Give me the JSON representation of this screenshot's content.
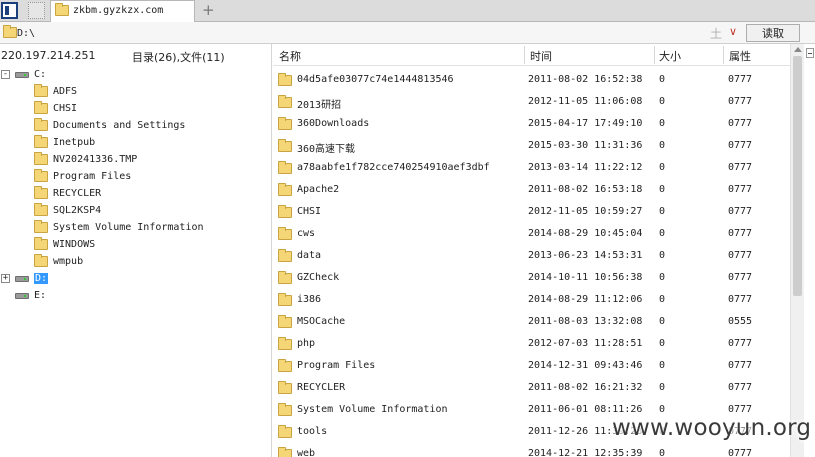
{
  "tab": {
    "title": "zkbm.gyzkzx.com",
    "add_symbol": "+"
  },
  "address": {
    "value": "D:\\",
    "clear_symbol": "土",
    "dropdown_symbol": "∨",
    "read_label": "读取"
  },
  "left": {
    "ip": "220.197.214.251",
    "counts": "目录(26),文件(11)",
    "tree": [
      {
        "label": "C:",
        "type": "drive",
        "expander": "-"
      },
      {
        "label": "ADFS",
        "type": "sub"
      },
      {
        "label": "CHSI",
        "type": "sub"
      },
      {
        "label": "Documents and Settings",
        "type": "sub"
      },
      {
        "label": "Inetpub",
        "type": "sub"
      },
      {
        "label": "NV20241336.TMP",
        "type": "sub"
      },
      {
        "label": "Program Files",
        "type": "sub"
      },
      {
        "label": "RECYCLER",
        "type": "sub"
      },
      {
        "label": "SQL2KSP4",
        "type": "sub"
      },
      {
        "label": "System Volume Information",
        "type": "sub"
      },
      {
        "label": "WINDOWS",
        "type": "sub"
      },
      {
        "label": "wmpub",
        "type": "sub"
      },
      {
        "label": "D:",
        "type": "drive",
        "expander": "+",
        "selected": true
      },
      {
        "label": "E:",
        "type": "drive"
      }
    ]
  },
  "right": {
    "headers": {
      "name": "名称",
      "time": "时间",
      "size": "大小",
      "attr": "属性"
    },
    "rows": [
      {
        "name": "04d5afe03077c74e1444813546",
        "time": "2011-08-02 16:52:38",
        "size": "0",
        "attr": "0777"
      },
      {
        "name": "2013研招",
        "time": "2012-11-05 11:06:08",
        "size": "0",
        "attr": "0777"
      },
      {
        "name": "360Downloads",
        "time": "2015-04-17 17:49:10",
        "size": "0",
        "attr": "0777"
      },
      {
        "name": "360高速下载",
        "time": "2015-03-30 11:31:36",
        "size": "0",
        "attr": "0777"
      },
      {
        "name": "a78aabfe1f782cce740254910aef3dbf",
        "time": "2013-03-14 11:22:12",
        "size": "0",
        "attr": "0777"
      },
      {
        "name": "Apache2",
        "time": "2011-08-02 16:53:18",
        "size": "0",
        "attr": "0777"
      },
      {
        "name": "CHSI",
        "time": "2012-11-05 10:59:27",
        "size": "0",
        "attr": "0777"
      },
      {
        "name": "cws",
        "time": "2014-08-29 10:45:04",
        "size": "0",
        "attr": "0777"
      },
      {
        "name": "data",
        "time": "2013-06-23 14:53:31",
        "size": "0",
        "attr": "0777"
      },
      {
        "name": "GZCheck",
        "time": "2014-10-11 10:56:38",
        "size": "0",
        "attr": "0777"
      },
      {
        "name": "i386",
        "time": "2014-08-29 11:12:06",
        "size": "0",
        "attr": "0777"
      },
      {
        "name": "MSOCache",
        "time": "2011-08-03 13:32:08",
        "size": "0",
        "attr": "0555"
      },
      {
        "name": "php",
        "time": "2012-07-03 11:28:51",
        "size": "0",
        "attr": "0777"
      },
      {
        "name": "Program Files",
        "time": "2014-12-31 09:43:46",
        "size": "0",
        "attr": "0777"
      },
      {
        "name": "RECYCLER",
        "time": "2011-08-02 16:21:32",
        "size": "0",
        "attr": "0777"
      },
      {
        "name": "System Volume Information",
        "time": "2011-06-01 08:11:26",
        "size": "0",
        "attr": "0777"
      },
      {
        "name": "tools",
        "time": "2011-12-26 11:39:23",
        "size": "0",
        "attr": "0777"
      },
      {
        "name": "web",
        "time": "2014-12-21 12:35:39",
        "size": "0",
        "attr": "0777"
      }
    ]
  },
  "watermark": "www.wooyun.org",
  "colors": {
    "selection": "#3399ff",
    "folder": "#f5d676",
    "tab_accent": "#1a3f7a"
  }
}
